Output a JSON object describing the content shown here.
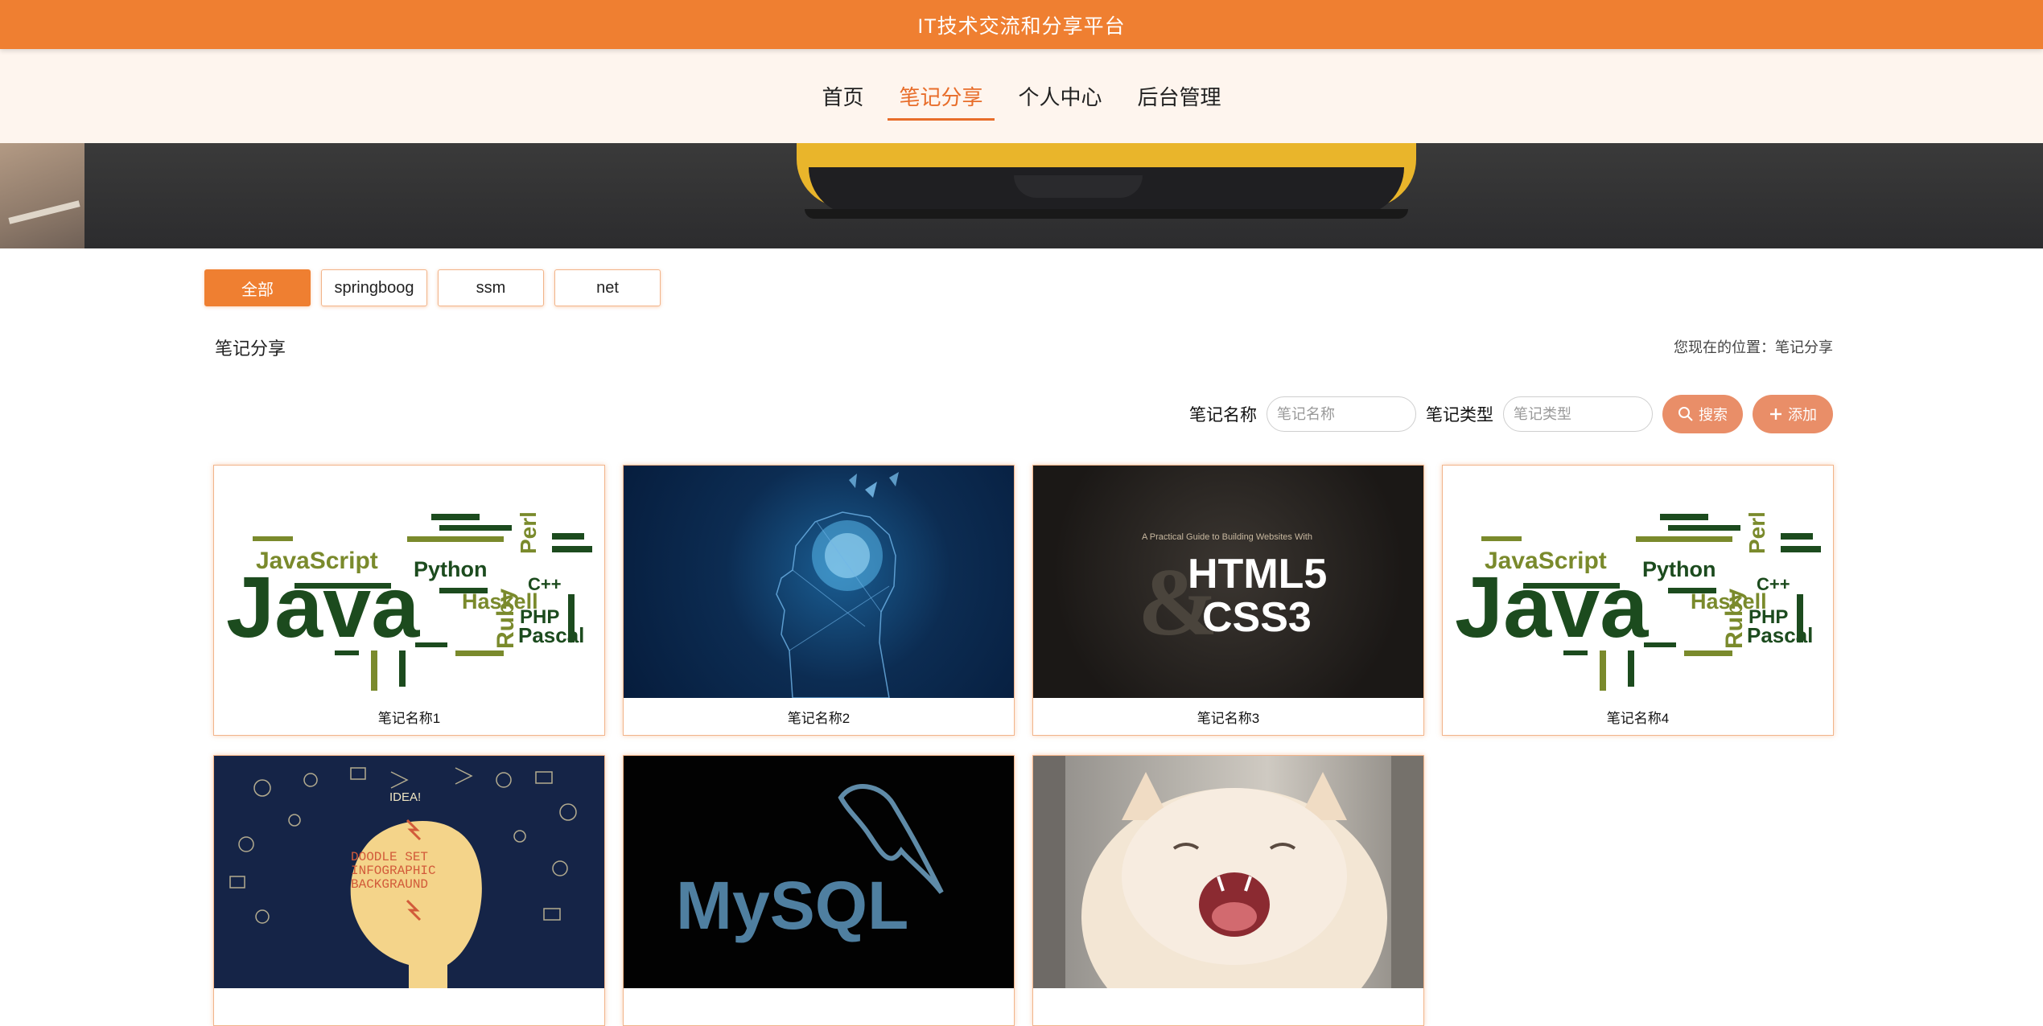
{
  "header": {
    "title": "IT技术交流和分享平台"
  },
  "nav": {
    "items": [
      {
        "label": "首页",
        "active": false
      },
      {
        "label": "笔记分享",
        "active": true
      },
      {
        "label": "个人中心",
        "active": false
      },
      {
        "label": "后台管理",
        "active": false
      }
    ]
  },
  "carousel": {
    "slide_count": 4,
    "active_index": 1
  },
  "filters": [
    {
      "label": "全部",
      "active": true
    },
    {
      "label": "springboog",
      "active": false
    },
    {
      "label": "ssm",
      "active": false
    },
    {
      "label": "net",
      "active": false
    }
  ],
  "page": {
    "title": "笔记分享",
    "breadcrumb": "您现在的位置：笔记分享"
  },
  "search": {
    "name_label": "笔记名称",
    "name_placeholder": "笔记名称",
    "type_label": "笔记类型",
    "type_placeholder": "笔记类型",
    "search_button": "搜索",
    "add_button": "添加"
  },
  "cards": [
    {
      "name": "笔记名称1",
      "image": "java-word-cloud"
    },
    {
      "name": "笔记名称2",
      "image": "digital-brain"
    },
    {
      "name": "笔记名称3",
      "image": "html5-css3-book"
    },
    {
      "name": "笔记名称4",
      "image": "java-word-cloud"
    },
    {
      "name": "",
      "image": "doodle-infographic"
    },
    {
      "name": "",
      "image": "mysql-logo"
    },
    {
      "name": "",
      "image": "yawning-cat"
    }
  ],
  "thumb_text": {
    "java": "Java",
    "javascript": "JavaScript",
    "python": "Python",
    "haskell": "Haskell",
    "pascal": "Pascal",
    "php": "PHP",
    "ruby": "Ruby",
    "perl": "Perl",
    "cpp": "C++",
    "html5": "HTML5",
    "css3": "CSS3",
    "book_subtitle": "A Practical Guide to Building Websites With",
    "doodle": "DOODLE SET INFOGRAPHIC BACKGRAUND",
    "idea": "IDEA!",
    "mysql": "MySQL"
  },
  "colors": {
    "accent": "#ef7f31",
    "nav_bg": "#fef5ee",
    "active_nav": "#e86d2a",
    "button": "#e98e68"
  }
}
